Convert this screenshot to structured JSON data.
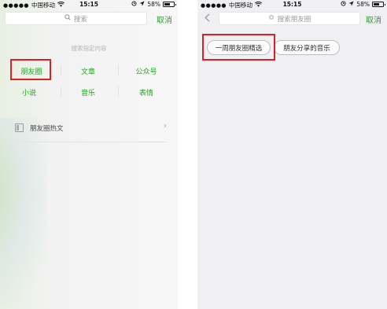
{
  "left_screen": {
    "status": {
      "carrier": "中国移动",
      "signal_dots": "●●●●●",
      "time": "15:15",
      "battery": "58%",
      "battery_fraction": 0.58
    },
    "search": {
      "placeholder": "搜索",
      "cancel": "取消"
    },
    "hint": "搜索指定内容",
    "categories": [
      {
        "label": "朋友圈"
      },
      {
        "label": "文章"
      },
      {
        "label": "公众号"
      },
      {
        "label": "小说"
      },
      {
        "label": "音乐"
      },
      {
        "label": "表情"
      }
    ],
    "hot": {
      "label": "朋友圈热文"
    }
  },
  "right_screen": {
    "status": {
      "carrier": "中国移动",
      "signal_dots": "●●●●●",
      "time": "15:15",
      "battery": "58%",
      "battery_fraction": 0.58
    },
    "search": {
      "placeholder": "搜索朋友圈",
      "cancel": "取消"
    },
    "chips": [
      {
        "label": "一周朋友圈精选"
      },
      {
        "label": "朋友分享的音乐"
      }
    ]
  },
  "colors": {
    "accent_green": "#1aad19",
    "highlight_red": "#e02020",
    "right_background": "#efeff4"
  },
  "icons": [
    "wifi-icon",
    "location-icon",
    "alarm-icon",
    "battery-icon",
    "search-icon",
    "back-chevron-icon",
    "article-icon",
    "chevron-right-icon"
  ]
}
